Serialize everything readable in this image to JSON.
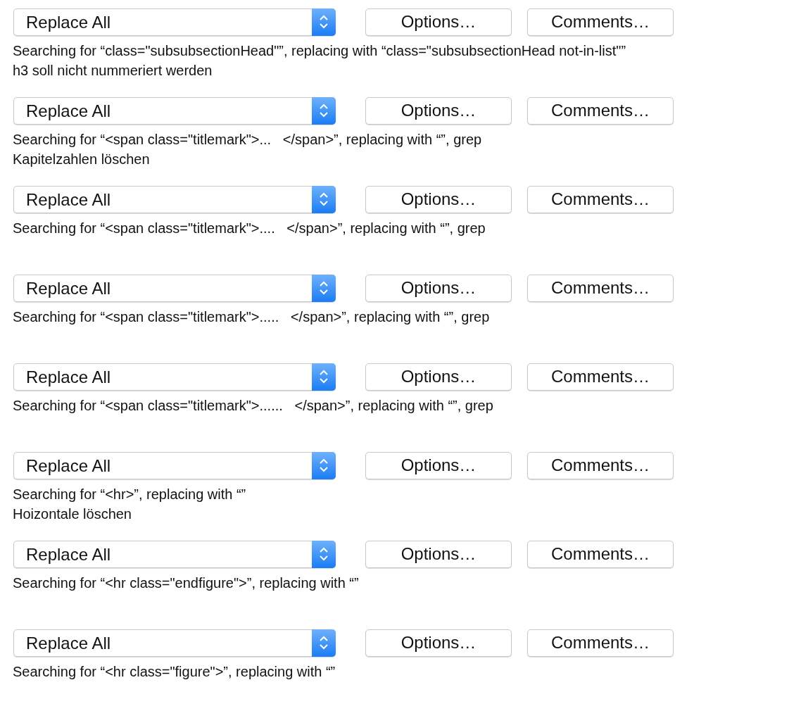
{
  "rules": [
    {
      "action": "Replace All",
      "options_button": "Options…",
      "comments_button": "Comments…",
      "summary": "Searching for “class=\"subsubsectionHead\"”, replacing with “class=\"subsubsectionHead not-in-list\"”",
      "comment": "h3 soll nicht nummeriert werden"
    },
    {
      "action": "Replace All",
      "options_button": "Options…",
      "comments_button": "Comments…",
      "summary": "Searching for “<span class=\"titlemark\">...   </span>”, replacing with “”, grep",
      "comment": "Kapitelzahlen löschen"
    },
    {
      "action": "Replace All",
      "options_button": "Options…",
      "comments_button": "Comments…",
      "summary": "Searching for “<span class=\"titlemark\">....   </span>”, replacing with “”, grep"
    },
    {
      "action": "Replace All",
      "options_button": "Options…",
      "comments_button": "Comments…",
      "summary": "Searching for “<span class=\"titlemark\">.....   </span>”, replacing with “”, grep"
    },
    {
      "action": "Replace All",
      "options_button": "Options…",
      "comments_button": "Comments…",
      "summary": "Searching for “<span class=\"titlemark\">......   </span>”, replacing with “”, grep"
    },
    {
      "action": "Replace All",
      "options_button": "Options…",
      "comments_button": "Comments…",
      "summary": "Searching for “<hr>”, replacing with “”",
      "comment": "Hoizontale löschen"
    },
    {
      "action": "Replace All",
      "options_button": "Options…",
      "comments_button": "Comments…",
      "summary": "Searching for “<hr class=\"endfigure\">”, replacing with “”"
    },
    {
      "action": "Replace All",
      "options_button": "Options…",
      "comments_button": "Comments…",
      "summary": "Searching for “<hr class=\"figure\">”, replacing with “”"
    }
  ]
}
